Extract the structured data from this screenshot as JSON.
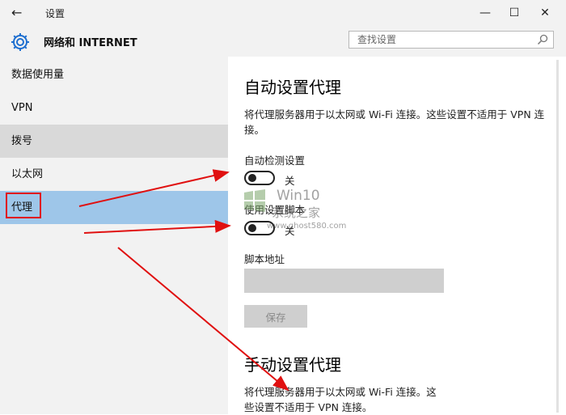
{
  "window": {
    "title": "设置",
    "back_icon": "arrow-left-icon",
    "controls": {
      "minimize": "—",
      "maximize": "☐",
      "close": "✕"
    }
  },
  "header": {
    "icon": "gear-icon",
    "title": "网络和 INTERNET",
    "search_placeholder": "查找设置"
  },
  "sidebar": {
    "items": [
      {
        "label": "数据使用量",
        "state": "normal"
      },
      {
        "label": "VPN",
        "state": "normal"
      },
      {
        "label": "拨号",
        "state": "hover"
      },
      {
        "label": "以太网",
        "state": "normal"
      },
      {
        "label": "代理",
        "state": "selected"
      }
    ]
  },
  "main": {
    "auto": {
      "heading": "自动设置代理",
      "description": "将代理服务器用于以太网或 Wi-Fi 连接。这些设置不适用于 VPN 连接。",
      "auto_detect_label": "自动检测设置",
      "auto_detect_state": "关",
      "use_script_label": "使用设置脚本",
      "use_script_state": "关",
      "script_address_label": "脚本地址",
      "script_address_value": "",
      "save_label": "保存"
    },
    "manual": {
      "heading": "手动设置代理",
      "description": "将代理服务器用于以太网或 Wi-Fi 连接。这些设置不适用于 VPN 连接。"
    }
  },
  "watermark": {
    "line1": "Win10",
    "line2": "系统之家",
    "url": "www.ghost580.com"
  },
  "colors": {
    "selected": "#9ec6e9",
    "hover": "#d9d9d9",
    "annotation": "#e01010"
  }
}
